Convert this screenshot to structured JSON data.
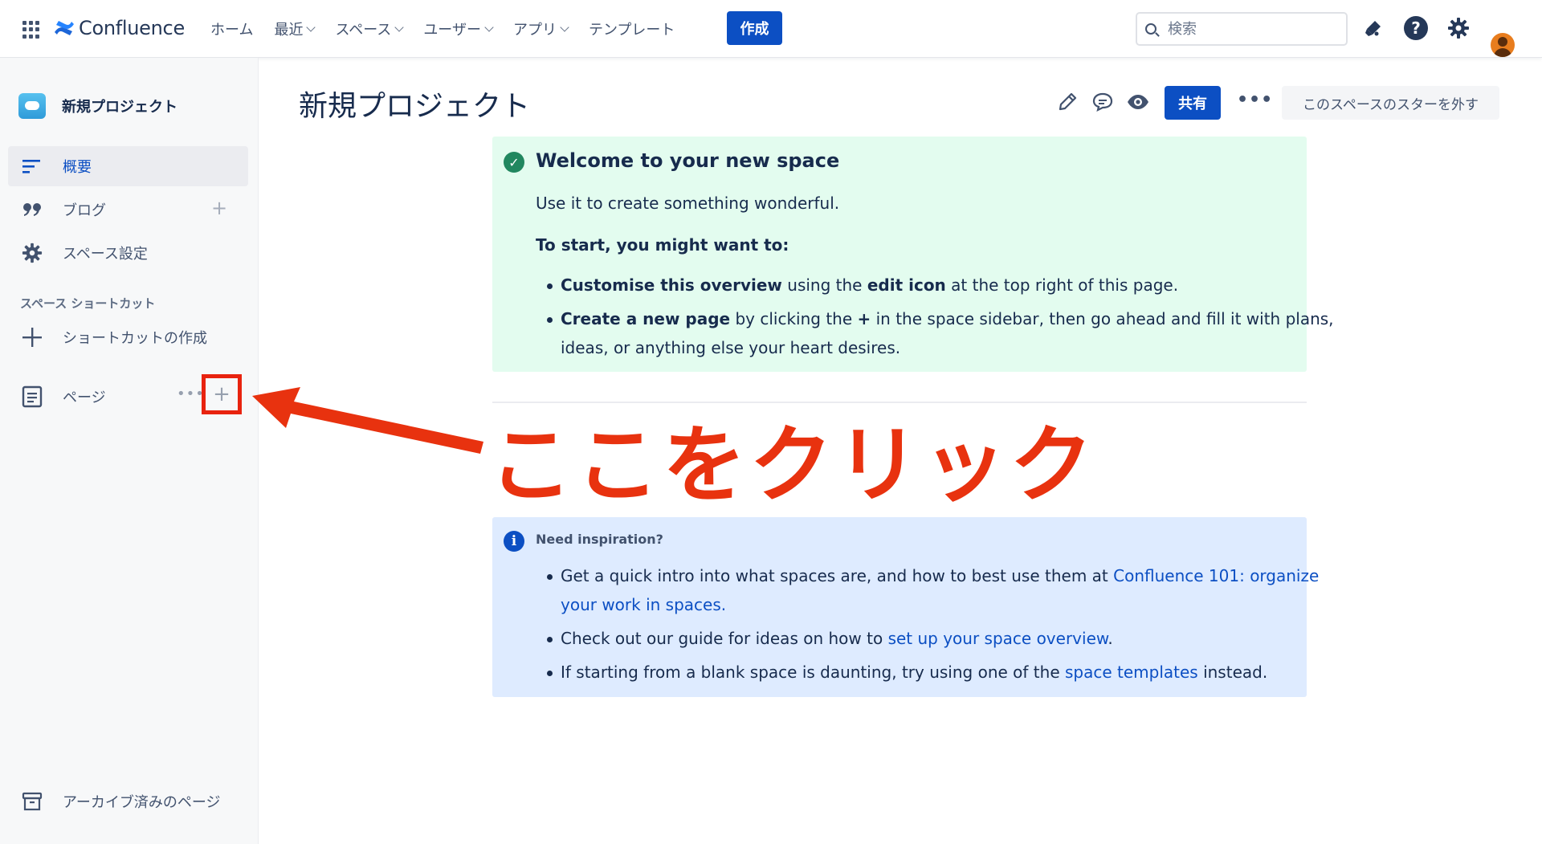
{
  "topnav": {
    "brand": "Confluence",
    "items": [
      {
        "label": "ホーム",
        "dropdown": false
      },
      {
        "label": "最近",
        "dropdown": true
      },
      {
        "label": "スペース",
        "dropdown": true
      },
      {
        "label": "ユーザー",
        "dropdown": true
      },
      {
        "label": "アプリ",
        "dropdown": true
      },
      {
        "label": "テンプレート",
        "dropdown": false
      }
    ],
    "create_label": "作成",
    "search_placeholder": "検索",
    "help_glyph": "?"
  },
  "sidebar": {
    "space_name": "新規プロジェクト",
    "items": [
      {
        "label": "概要",
        "icon": "overview-lines-icon",
        "active": true
      },
      {
        "label": "ブログ",
        "icon": "quote-icon",
        "active": false
      },
      {
        "label": "スペース設定",
        "icon": "gear-icon",
        "active": false
      }
    ],
    "shortcuts_heading": "スペース ショートカット",
    "create_shortcut_label": "ショートカットの作成",
    "pages_label": "ページ",
    "more_glyph": "•••",
    "plus_glyph": "+",
    "archived_label": "アーカイブ済みのページ"
  },
  "main": {
    "title": "新規プロジェクト",
    "share_label": "共有",
    "more_glyph": "•••",
    "unstar_label": "このスペースのスターを外す"
  },
  "welcome_panel": {
    "heading": "Welcome to your new space",
    "intro": "Use it to create something wonderful.",
    "start_heading": "To start, you might want to:",
    "bullet1": {
      "bold1": "Customise this overview",
      "text1": " using the ",
      "bold2": "edit icon",
      "text2": " at the top right of this page."
    },
    "bullet2": {
      "bold1": "Create a new page",
      "text1": " by clicking the ",
      "bold2": "+",
      "text2": " in the space sidebar, then go ahead and fill it with plans,",
      "line2": "ideas, or anything else your heart desires."
    }
  },
  "inspiration_panel": {
    "heading": "Need inspiration?",
    "bullet1": {
      "text": "Get a quick intro into what spaces are, and how to best use them at ",
      "link": "Confluence 101: organize",
      "link_line2": "your work in spaces."
    },
    "bullet2": {
      "text": "Check out our guide for ideas on how to ",
      "link": "set up your space overview",
      "tail": "."
    },
    "bullet3": {
      "text": "If starting from a blank space is daunting, try using one of the ",
      "link": "space templates",
      "tail": " instead."
    }
  },
  "annotation": {
    "text": "ここをクリック",
    "color": "#e8320f"
  },
  "colors": {
    "primary": "#0c4fc3",
    "success": "#21875f",
    "panel_green": "#e3fcef",
    "panel_blue": "#deebff"
  }
}
